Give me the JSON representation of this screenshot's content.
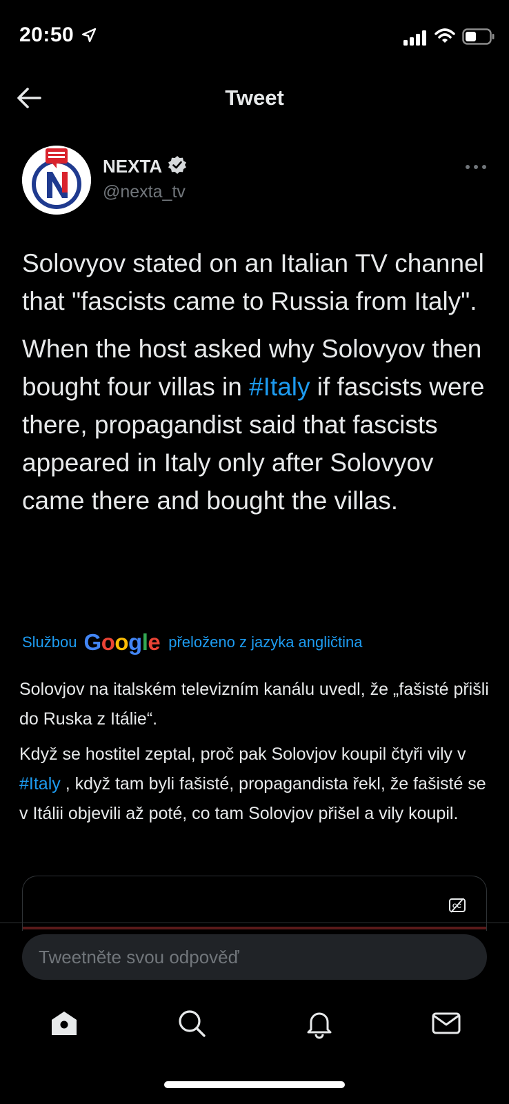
{
  "status_bar": {
    "time": "20:50"
  },
  "header": {
    "title": "Tweet"
  },
  "author": {
    "name": "NEXTA",
    "handle": "@nexta_tv",
    "verified": true
  },
  "tweet": {
    "paragraph1": "Solovyov stated on an Italian TV channel that \"fascists came to Russia from Italy\".",
    "paragraph2_before": "When the host asked why Solovyov then bought four villas in ",
    "paragraph2_hashtag": "#Italy",
    "paragraph2_after": " if fascists were there, propagandist said that fascists appeared in Italy only after Solovyov came there and bought the villas."
  },
  "translation": {
    "credit_prefix": "Službou",
    "google": "Google",
    "credit_suffix": "přeloženo z jazyka angličtina",
    "paragraph1": "Solovjov na italském televizním kanálu uvedl, že „fašisté přišli do Ruska z Itálie“.",
    "paragraph2_before": " Když se hostitel zeptal, proč pak Solovjov koupil čtyři vily v ",
    "paragraph2_hashtag": "#Italy",
    "paragraph2_after": " , když tam byli fašisté, propagandista řekl, že fašisté se v Itálii objevili až poté, co tam Solovjov přišel a vily koupil."
  },
  "reply": {
    "placeholder": "Tweetněte svou odpověď"
  },
  "tabs": [
    "home-icon",
    "search-icon",
    "notifications-icon",
    "messages-icon"
  ],
  "colors": {
    "background": "#000000",
    "text": "#e7e9ea",
    "secondary": "#71767b",
    "accent": "#1d9bf0"
  }
}
